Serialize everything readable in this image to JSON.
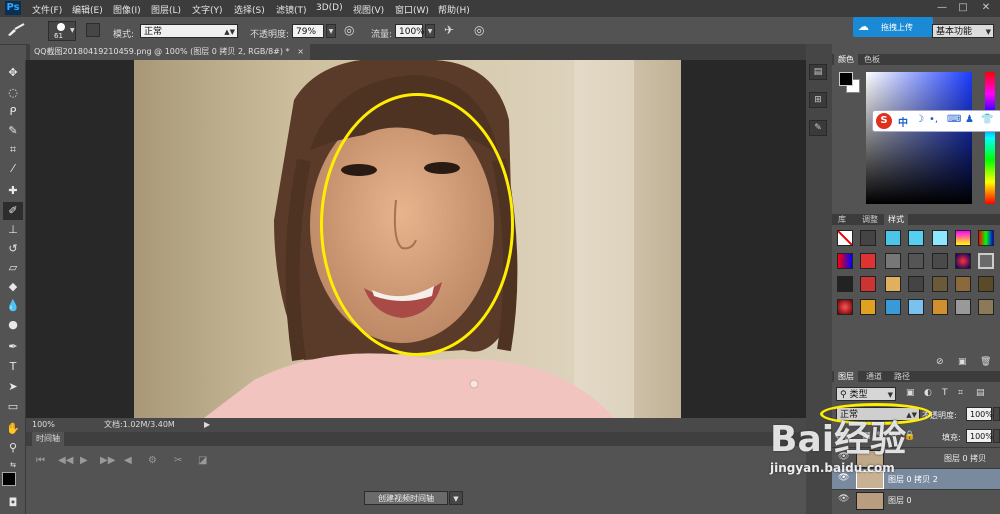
{
  "menubar": {
    "logo": "Ps",
    "items": [
      "文件(F)",
      "编辑(E)",
      "图像(I)",
      "图层(L)",
      "文字(Y)",
      "选择(S)",
      "滤镜(T)",
      "3D(D)",
      "视图(V)",
      "窗口(W)",
      "帮助(H)"
    ],
    "window_controls": [
      "—",
      "□",
      "✕"
    ]
  },
  "options": {
    "brush_size": "61",
    "mode_label": "模式:",
    "mode_value": "正常",
    "opacity_label": "不透明度:",
    "opacity_value": "79%",
    "flow_label": "流量:",
    "flow_value": "100%",
    "upload_label": "拖拽上传",
    "workspace": "基本功能"
  },
  "document": {
    "tab_title": "QQ截图20180419210459.png @ 100% (图层 0 拷贝 2, RGB/8#) *",
    "tab_close": "×",
    "zoom": "100%",
    "doc_info": "文档:1.02M/3.40M"
  },
  "timeline": {
    "title": "时间轴",
    "create_button": "创建视频时间轴"
  },
  "panels": {
    "color_tabs": [
      "颜色",
      "色板"
    ],
    "styles_tabs": [
      "库",
      "调整",
      "样式"
    ],
    "layers_tabs": [
      "图层",
      "通道",
      "路径"
    ],
    "filter_kind": "类型",
    "blend_mode": "正常",
    "opacity_label": "不透明度:",
    "opacity_value": "100%",
    "lock_label": "锁定:",
    "fill_label": "填充:",
    "fill_value": "100%",
    "layers": [
      {
        "name": "图层 0 拷贝"
      },
      {
        "name": "图层 0 拷贝 2"
      },
      {
        "name": "图层 0"
      }
    ]
  },
  "ime_bar": {
    "items": [
      "S",
      "中"
    ]
  },
  "watermark": {
    "brand": "Bai经验",
    "url": "jingyan.baidu.com"
  },
  "colors": {
    "ui_dark": "#3c3c3c",
    "ui_mid": "#535353",
    "highlight": "#ffee00",
    "upload_blue": "#1b8ad6"
  }
}
